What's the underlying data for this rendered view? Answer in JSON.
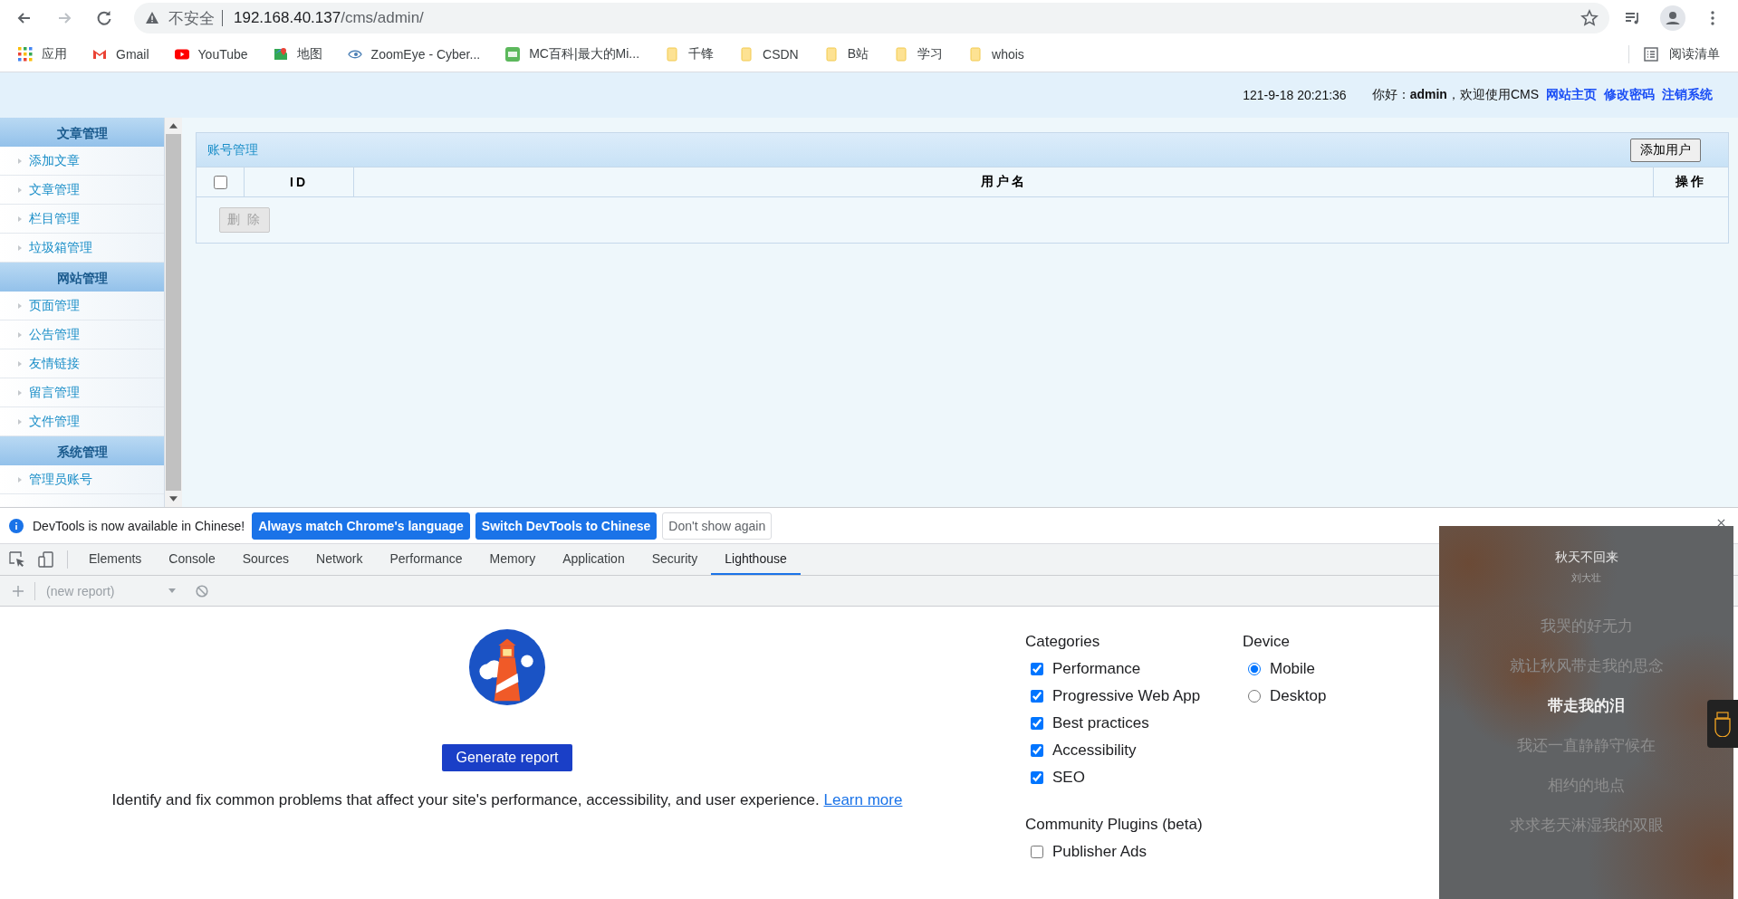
{
  "browser": {
    "address": {
      "security_label": "不安全",
      "host": "192.168.40.137",
      "path": "/cms/admin/"
    },
    "bookmarks": [
      {
        "label": "应用",
        "kind": "apps"
      },
      {
        "label": "Gmail",
        "kind": "gmail"
      },
      {
        "label": "YouTube",
        "kind": "youtube"
      },
      {
        "label": "地图",
        "kind": "maps"
      },
      {
        "label": "ZoomEye - Cyber...",
        "kind": "eye"
      },
      {
        "label": "MC百科|最大的Mi...",
        "kind": "mc"
      },
      {
        "label": "千锋",
        "kind": "folder"
      },
      {
        "label": "CSDN",
        "kind": "folder"
      },
      {
        "label": "B站",
        "kind": "folder"
      },
      {
        "label": "学习",
        "kind": "folder"
      },
      {
        "label": "whois",
        "kind": "folder"
      }
    ],
    "reading_list": "阅读清单"
  },
  "cms": {
    "header": {
      "datetime": "121-9-18 20:21:36",
      "greeting": "你好：",
      "user": "admin",
      "welcome": "，欢迎使用CMS",
      "links": [
        "网站主页",
        "修改密码",
        "注销系统"
      ]
    },
    "sidebar": [
      {
        "title": "文章管理",
        "items": [
          "添加文章",
          "文章管理",
          "栏目管理",
          "垃圾箱管理"
        ]
      },
      {
        "title": "网站管理",
        "items": [
          "页面管理",
          "公告管理",
          "友情链接",
          "留言管理",
          "文件管理"
        ]
      },
      {
        "title": "系统管理",
        "items": [
          "管理员账号"
        ]
      }
    ],
    "panel": {
      "title": "账号管理",
      "add_button": "添加用户",
      "select_all": {
        "checked": false
      },
      "columns": [
        "ID",
        "用户名",
        "操作"
      ],
      "delete_button": {
        "label": "删 除",
        "disabled": true
      }
    }
  },
  "devtools": {
    "infobar": {
      "message": "DevTools is now available in Chinese!",
      "buttons": [
        {
          "label": "Always match Chrome's language",
          "kind": "primary"
        },
        {
          "label": "Switch DevTools to Chinese",
          "kind": "primary"
        },
        {
          "label": "Don't show again",
          "kind": "secondary"
        }
      ]
    },
    "tabs": [
      {
        "label": "Elements",
        "selected": false
      },
      {
        "label": "Console",
        "selected": false
      },
      {
        "label": "Sources",
        "selected": false
      },
      {
        "label": "Network",
        "selected": false
      },
      {
        "label": "Performance",
        "selected": false
      },
      {
        "label": "Memory",
        "selected": false
      },
      {
        "label": "Application",
        "selected": false
      },
      {
        "label": "Security",
        "selected": false
      },
      {
        "label": "Lighthouse",
        "selected": true
      }
    ],
    "report_select": "(new report)",
    "lighthouse": {
      "generate_button": "Generate report",
      "description": "Identify and fix common problems that affect your site's performance, accessibility, and user experience.",
      "learn_more": "Learn more",
      "categories_title": "Categories",
      "categories": [
        {
          "label": "Performance",
          "checked": true
        },
        {
          "label": "Progressive Web App",
          "checked": true
        },
        {
          "label": "Best practices",
          "checked": true
        },
        {
          "label": "Accessibility",
          "checked": true
        },
        {
          "label": "SEO",
          "checked": true
        }
      ],
      "device_title": "Device",
      "devices": [
        {
          "label": "Mobile",
          "selected": true
        },
        {
          "label": "Desktop",
          "selected": false
        }
      ],
      "plugins_title": "Community Plugins (beta)",
      "plugins": [
        {
          "label": "Publisher Ads",
          "checked": false
        }
      ]
    }
  },
  "music": {
    "title": "秋天不回来",
    "artist": "刘大壮",
    "lines": [
      {
        "text": "我哭的好无力",
        "current": false
      },
      {
        "text": "就让秋风带走我的思念",
        "current": false
      },
      {
        "text": "带走我的泪",
        "current": true
      },
      {
        "text": "我还一直静静守候在",
        "current": false
      },
      {
        "text": "相约的地点",
        "current": false
      },
      {
        "text": "求求老天淋湿我的双眼",
        "current": false
      }
    ]
  }
}
